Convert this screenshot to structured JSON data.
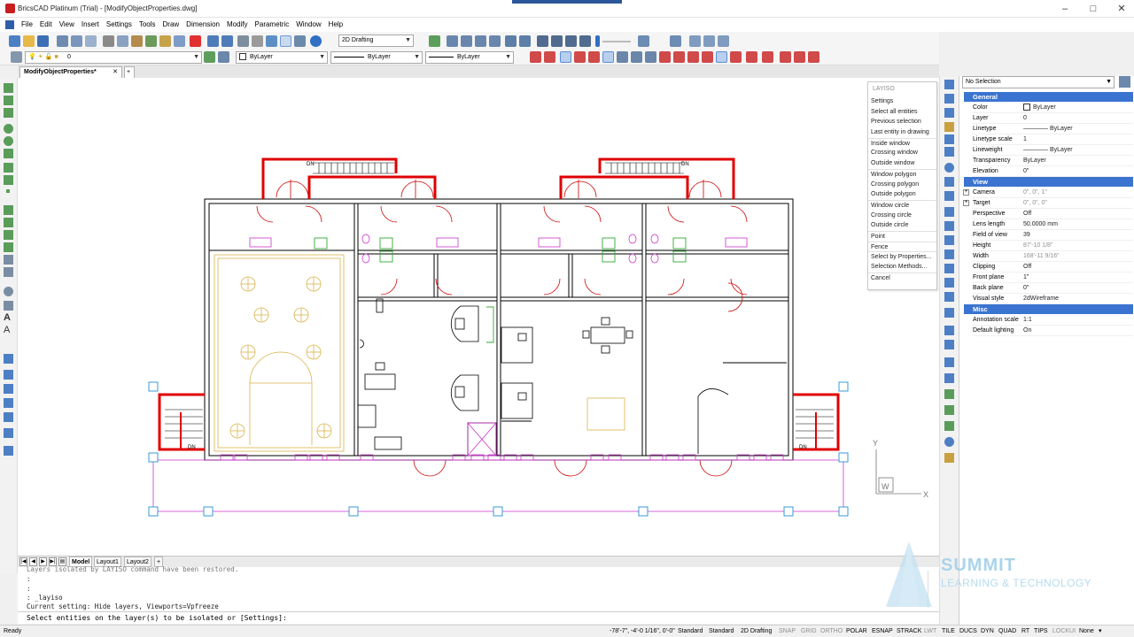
{
  "window": {
    "title": "BricsCAD Platinum (Trial) - [ModifyObjectProperties.dwg]",
    "controls": [
      "–",
      "□",
      "✕"
    ]
  },
  "menu": [
    "File",
    "Edit",
    "View",
    "Insert",
    "Settings",
    "Tools",
    "Draw",
    "Dimension",
    "Modify",
    "Parametric",
    "Window",
    "Help"
  ],
  "toolbar": {
    "workspace": "2D Drafting",
    "layer": "0",
    "color": "ByLayer",
    "linetype": "ByLayer",
    "lineweight": "ByLayer"
  },
  "doc_tab": "ModifyObjectProperties*",
  "doc_tab_close": "✕",
  "doc_tab_add": "+",
  "context_menu": {
    "title": "LAYISO",
    "items": [
      "Settings",
      "Select all entities",
      "Previous selection",
      "Last entity in drawing",
      "Inside window",
      "Crossing window",
      "Outside window",
      "Window polygon",
      "Crossing polygon",
      "Outside polygon",
      "Window circle",
      "Crossing circle",
      "Outside circle",
      "Point",
      "Fence",
      "Select by Properties...",
      "Selection Methods...",
      "Cancel"
    ]
  },
  "layout_tabs": [
    "Model",
    "Layout1",
    "Layout2"
  ],
  "layout_tab_add": "+",
  "command_line": {
    "lines": [
      "Layers isolated by LAYISO command have been restored.",
      ":",
      ":",
      ": _layiso",
      "Current setting: Hide layers, Viewports=Vpfreeze"
    ],
    "prompt": "Select entities on the layer(s) to be isolated or [Settings]:"
  },
  "statusbar": {
    "ready": "Ready",
    "coords": "-78'-7\", -4'-0 1/16\", 0'-0\"",
    "items": [
      {
        "label": "Standard",
        "on": true
      },
      {
        "label": "Standard",
        "on": true
      },
      {
        "label": "2D Drafting",
        "on": true
      },
      {
        "label": "SNAP",
        "on": false
      },
      {
        "label": "GRID",
        "on": false
      },
      {
        "label": "ORTHO",
        "on": false
      },
      {
        "label": "POLAR",
        "on": true
      },
      {
        "label": "ESNAP",
        "on": true
      },
      {
        "label": "STRACK",
        "on": true
      },
      {
        "label": "LWT",
        "on": false
      },
      {
        "label": "TILE",
        "on": true
      },
      {
        "label": "DUCS",
        "on": true
      },
      {
        "label": "DYN",
        "on": true
      },
      {
        "label": "QUAD",
        "on": true
      },
      {
        "label": "RT",
        "on": true
      },
      {
        "label": "TIPS",
        "on": true
      },
      {
        "label": "LOCKUI",
        "on": false
      },
      {
        "label": "None",
        "on": true
      }
    ]
  },
  "properties": {
    "selection": "No Selection",
    "categories": [
      {
        "name": "General",
        "rows": [
          {
            "k": "Color",
            "v": "ByLayer"
          },
          {
            "k": "Layer",
            "v": "0"
          },
          {
            "k": "Linetype",
            "v": "———— ByLayer"
          },
          {
            "k": "Linetype scale",
            "v": "1"
          },
          {
            "k": "Lineweight",
            "v": "———— ByLayer"
          },
          {
            "k": "Transparency",
            "v": "ByLayer"
          },
          {
            "k": "Elevation",
            "v": "0\""
          }
        ]
      },
      {
        "name": "View",
        "rows": [
          {
            "k": "Camera",
            "v": "0\", 0\", 1\"",
            "muted": true
          },
          {
            "k": "Target",
            "v": "0\", 0\", 0\"",
            "muted": true
          },
          {
            "k": "Perspective",
            "v": "Off"
          },
          {
            "k": "Lens length",
            "v": "50.0000 mm"
          },
          {
            "k": "Field of view",
            "v": "39"
          },
          {
            "k": "Height",
            "v": "87'-10 1/8\"",
            "muted": true
          },
          {
            "k": "Width",
            "v": "168'-11 9/16\"",
            "muted": true
          },
          {
            "k": "Clipping",
            "v": "Off"
          },
          {
            "k": "Front plane",
            "v": "1\""
          },
          {
            "k": "Back plane",
            "v": "0\""
          },
          {
            "k": "Visual style",
            "v": "2dWireframe"
          }
        ]
      },
      {
        "name": "Misc",
        "rows": [
          {
            "k": "Annotation scale",
            "v": "1:1"
          },
          {
            "k": "Default lighting",
            "v": "On"
          }
        ]
      }
    ]
  },
  "drawing": {
    "door_labels": [
      "DN",
      "DN",
      "DN",
      "DN"
    ],
    "ucs": {
      "x": "X",
      "y": "Y",
      "w": "W"
    }
  },
  "watermark": {
    "line1": "SUMMIT",
    "line2": "LEARNING & TECHNOLOGY"
  },
  "colors": {
    "wall": "#000000",
    "red": "#e00000",
    "magenta": "#cc33cc",
    "yellow": "#d9b34a",
    "green": "#33aa33",
    "grip": "#3a9ad9",
    "accent": "#3a74d0"
  }
}
